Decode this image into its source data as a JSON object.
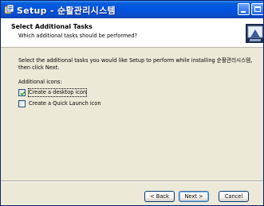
{
  "window": {
    "title": "Setup - 순활관리시스템"
  },
  "header": {
    "title": "Select Additional Tasks",
    "subtitle": "Which additional tasks should be performed?"
  },
  "body": {
    "intro": "Select the additional tasks you would like Setup to perform while installing 순활관리시스템, then click Next.",
    "group_label": "Additional icons:",
    "tasks": [
      {
        "label": "Create a desktop icon",
        "checked": true
      },
      {
        "label": "Create a Quick Launch icon",
        "checked": false
      }
    ]
  },
  "buttons": {
    "back": "< Back",
    "next": "Next >",
    "cancel": "Cancel"
  },
  "colors": {
    "title_bar": "#0054e3",
    "dialog": "#ece9d8",
    "check": "#21a121"
  }
}
